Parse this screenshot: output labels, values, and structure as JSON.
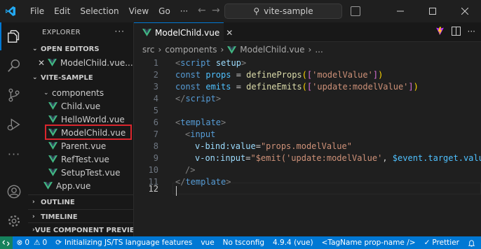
{
  "app": {
    "menu": [
      "File",
      "Edit",
      "Selection",
      "View",
      "Go"
    ],
    "more": "···",
    "search_text": "vite-sample"
  },
  "sidebar": {
    "title": "EXPLORER",
    "more": "···",
    "open_editors_header": "OPEN EDITORS",
    "open_editor_file": "ModelChild.vue...",
    "project_header": "VITE-SAMPLE",
    "folder": "components",
    "files": [
      "Child.vue",
      "HelloWorld.vue",
      "ModelChild.vue",
      "Parent.vue",
      "RefTest.vue",
      "SetupTest.vue"
    ],
    "root_file": "App.vue",
    "outline_header": "OUTLINE",
    "timeline_header": "TIMELINE",
    "vue_preview_header": "VUE COMPONENT PREVIEW"
  },
  "editor": {
    "tab_label": "ModelChild.vue",
    "breadcrumb": [
      "src",
      "components",
      "ModelChild.vue",
      "..."
    ],
    "line_numbers": [
      "1",
      "2",
      "3",
      "4",
      "5",
      "6",
      "7",
      "8",
      "9",
      "10",
      "11",
      "12"
    ],
    "lines": {
      "l1a": "<",
      "l1b": "script",
      "l1c": " ",
      "l1d": "setup",
      "l1e": ">",
      "l2a": "const",
      "l2b": "props",
      "l2c": " = ",
      "l2d": "defineProps",
      "l2e": "(",
      "l2f": "[",
      "l2g": "'modelValue'",
      "l2h": "]",
      "l2i": ")",
      "l3a": "const",
      "l3b": "emits",
      "l3c": " = ",
      "l3d": "defineEmits",
      "l3e": "(",
      "l3f": "[",
      "l3g": "'update:modelValue'",
      "l3h": "]",
      "l3i": ")",
      "l4a": "</",
      "l4b": "script",
      "l4c": ">",
      "l6a": "<",
      "l6b": "template",
      "l6c": ">",
      "l7a": "<",
      "l7b": "input",
      "l8a": "v-bind:value",
      "l8b": "=",
      "l8c": "\"props.modelValue\"",
      "l9a": "v-on:input",
      "l9b": "=",
      "l9c": "\"$emit(",
      "l9d": "'update:modelValue'",
      "l9e": ", ",
      "l9f": "$event.target.value",
      "l9g": ")\"",
      "l10a": "/>",
      "l11a": "</",
      "l11b": "template",
      "l11c": ">"
    }
  },
  "status": {
    "errors": "0",
    "warnings": "0",
    "message": "Initializing JS/TS language features",
    "language": "vue",
    "tsconfig": "No tsconfig",
    "version": "4.9.4 (vue)",
    "tagname": "<TagName prop-name />",
    "prettier": "Prettier"
  },
  "colors": {
    "accent": "#0078d4",
    "selection_outline": "#d9262d",
    "vue_green": "#41b883"
  }
}
